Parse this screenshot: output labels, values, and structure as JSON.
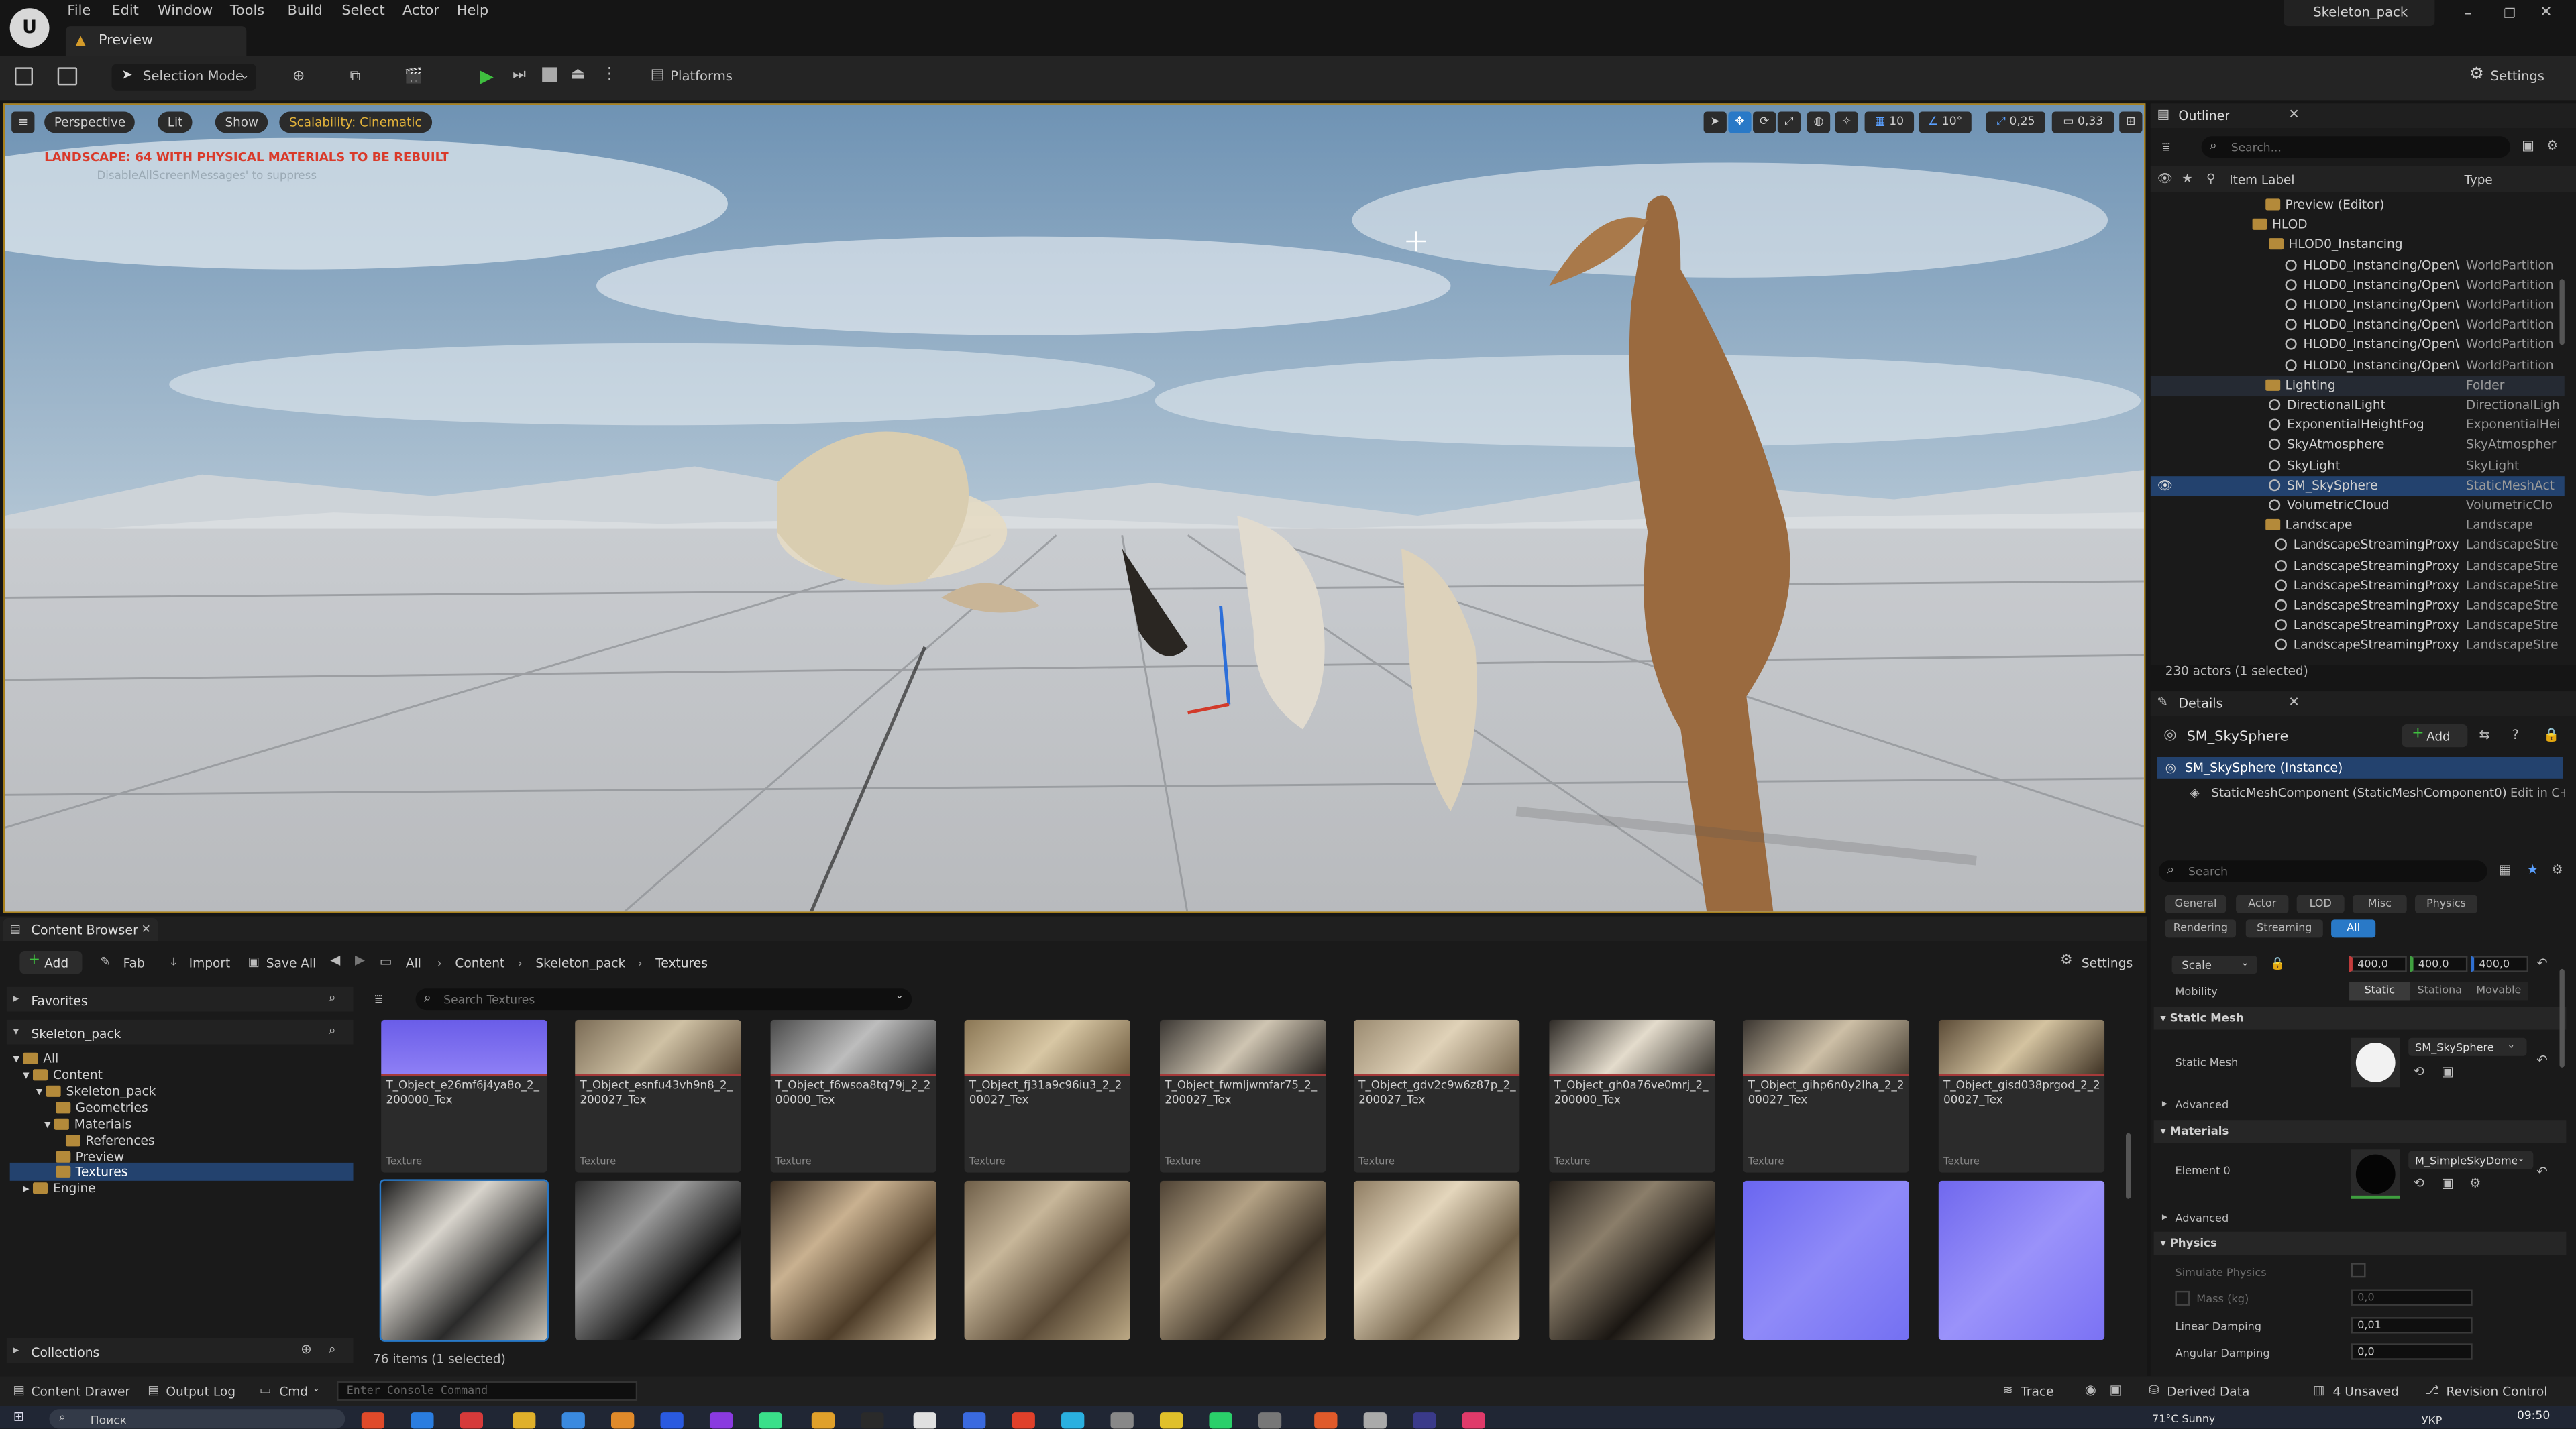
{
  "titlebar": {
    "project": "Skeleton_pack"
  },
  "menu": [
    "File",
    "Edit",
    "Window",
    "Tools",
    "Build",
    "Select",
    "Actor",
    "Help"
  ],
  "level_tab": "Preview",
  "toolbar": {
    "selection_mode": "Selection Mode",
    "platforms": "Platforms",
    "settings": "Settings"
  },
  "viewport": {
    "perspective": "Perspective",
    "lit": "Lit",
    "show": "Show",
    "scalability": "Scalability: Cinematic",
    "warning": "LANDSCAPE: 64  WITH PHYSICAL MATERIALS  TO BE REBUILT",
    "suppress": "DisableAllScreenMessages' to suppress",
    "grid_snap": "10",
    "rot_snap": "10°",
    "scale_snap": "0,25",
    "cam_speed": "0,33"
  },
  "outliner": {
    "title": "Outliner",
    "search_placeholder": "Search...",
    "col_label": "Item Label",
    "col_type": "Type",
    "rows": [
      {
        "label": "Preview (Editor)",
        "type": ""
      },
      {
        "label": "HLOD",
        "type": ""
      },
      {
        "label": "HLOD0_Instancing",
        "type": ""
      },
      {
        "label": "HLOD0_Instancing/OpenW",
        "type": "WorldPartition"
      },
      {
        "label": "HLOD0_Instancing/OpenW",
        "type": "WorldPartition"
      },
      {
        "label": "HLOD0_Instancing/OpenW",
        "type": "WorldPartition"
      },
      {
        "label": "HLOD0_Instancing/OpenW",
        "type": "WorldPartition"
      },
      {
        "label": "HLOD0_Instancing/OpenW",
        "type": "WorldPartition"
      },
      {
        "label": "HLOD0_Instancing/OpenW",
        "type": "WorldPartition"
      },
      {
        "label": "Lighting",
        "type": "Folder"
      },
      {
        "label": "DirectionalLight",
        "type": "DirectionalLigh"
      },
      {
        "label": "ExponentialHeightFog",
        "type": "ExponentialHei"
      },
      {
        "label": "SkyAtmosphere",
        "type": "SkyAtmospher"
      },
      {
        "label": "SkyLight",
        "type": "SkyLight"
      },
      {
        "label": "SM_SkySphere",
        "type": "StaticMeshAct"
      },
      {
        "label": "VolumetricCloud",
        "type": "VolumetricClo"
      },
      {
        "label": "Landscape",
        "type": "Landscape"
      },
      {
        "label": "LandscapeStreamingProxy_(",
        "type": "LandscapeStre"
      },
      {
        "label": "LandscapeStreamingProxy_(",
        "type": "LandscapeStre"
      },
      {
        "label": "LandscapeStreamingProxy_(",
        "type": "LandscapeStre"
      },
      {
        "label": "LandscapeStreamingProxy_(",
        "type": "LandscapeStre"
      },
      {
        "label": "LandscapeStreamingProxy_(",
        "type": "LandscapeStre"
      },
      {
        "label": "LandscapeStreamingProxy_(",
        "type": "LandscapeStre"
      }
    ],
    "status": "230 actors (1 selected)"
  },
  "details": {
    "title": "Details",
    "actor": "SM_SkySphere",
    "add": "Add",
    "instance": "SM_SkySphere (Instance)",
    "component": "StaticMeshComponent (StaticMeshComponent0)",
    "edit_in": "Edit in C++",
    "search_placeholder": "Search",
    "tabs": [
      "General",
      "Actor",
      "LOD",
      "Misc",
      "Physics",
      "Rendering",
      "Streaming",
      "All"
    ],
    "scale_label": "Scale",
    "scale": [
      "400,0",
      "400,0",
      "400,0"
    ],
    "mobility": "Mobility",
    "mobility_opts": [
      "Static",
      "Stationa",
      "Movable"
    ],
    "static_mesh_section": "Static Mesh",
    "static_mesh_label": "Static Mesh",
    "static_mesh_value": "SM_SkySphere",
    "advanced": "Advanced",
    "materials_section": "Materials",
    "element0": "Element 0",
    "element0_value": "M_SimpleSkyDome",
    "advanced2": "Advanced",
    "physics_section": "Physics",
    "simulate": "Simulate Physics",
    "mass": "Mass (kg)",
    "mass_value": "0,0",
    "linear_damping": "Linear Damping",
    "linear_value": "0,01",
    "angular_damping": "Angular Damping",
    "angular_value": "0,0"
  },
  "content_browser": {
    "tab": "Content Browser",
    "add": "Add",
    "fab": "Fab",
    "import": "Import",
    "save_all": "Save All",
    "path": [
      "All",
      "Content",
      "Skeleton_pack",
      "Textures"
    ],
    "settings": "Settings",
    "favorites": "Favorites",
    "root": "Skeleton_pack",
    "tree": [
      "All",
      "Content",
      "Skeleton_pack",
      "Geometries",
      "Materials",
      "References",
      "Preview",
      "Textures",
      "Engine"
    ],
    "search_placeholder": "Search Textures",
    "collections": "Collections",
    "status": "76 items (1 selected)",
    "assets": [
      {
        "name": "T_Object_e26mf6j4ya8o_2_200000_Tex",
        "kind": "Texture"
      },
      {
        "name": "T_Object_esnfu43vh9n8_2_200027_Tex",
        "kind": "Texture"
      },
      {
        "name": "T_Object_f6wsoa8tq79j_2_200000_Tex",
        "kind": "Texture"
      },
      {
        "name": "T_Object_fj31a9c96iu3_2_200027_Tex",
        "kind": "Texture"
      },
      {
        "name": "T_Object_fwmljwmfar75_2_200027_Tex",
        "kind": "Texture"
      },
      {
        "name": "T_Object_gdv2c9w6z87p_2_200027_Tex",
        "kind": "Texture"
      },
      {
        "name": "T_Object_gh0a76ve0mrj_2_200000_Tex",
        "kind": "Texture"
      },
      {
        "name": "T_Object_gihp6n0y2lha_2_200027_Tex",
        "kind": "Texture"
      },
      {
        "name": "T_Object_gisd038prgod_2_200027_Tex",
        "kind": "Texture"
      }
    ]
  },
  "statusbar": {
    "content_drawer": "Content Drawer",
    "output_log": "Output Log",
    "cmd": "Cmd",
    "console_placeholder": "Enter Console Command",
    "trace": "Trace",
    "derived": "Derived Data",
    "unsaved": "4 Unsaved",
    "revision": "Revision Control"
  },
  "taskbar": {
    "search": "Поиск",
    "clock": "09:50",
    "lang": "УКР",
    "weather": "71°C Sunny"
  },
  "colors": {
    "accent": "#2979c7",
    "viewport_border": "#a9811d",
    "warning": "#d93a2a",
    "scalability": "#d2a11e"
  }
}
